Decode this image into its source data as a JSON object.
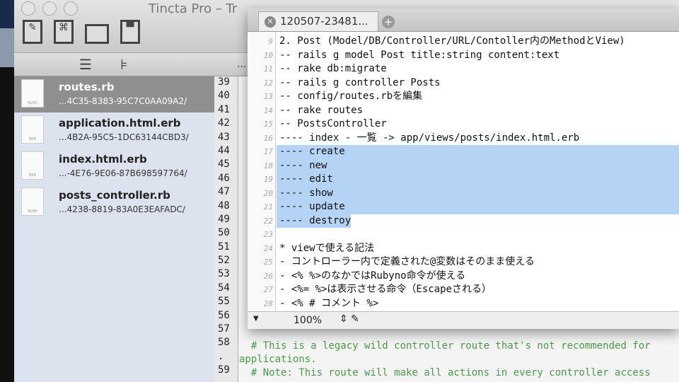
{
  "window": {
    "title": "Tincta Pro – Tr"
  },
  "toolbar": {
    "new": "new-document",
    "new_cmd": "⌘",
    "open": "open",
    "save": "save"
  },
  "sidebar": {
    "files": [
      {
        "name": "routes.rb",
        "path": "...4C35-8383-95C7C0AA09A2/",
        "type": "RUBY",
        "selected": true
      },
      {
        "name": "application.html.erb",
        "path": "...4B2A-95C5-1DC63144CBD3/",
        "type": "ERB"
      },
      {
        "name": "index.html.erb",
        "path": "...-4E76-9E06-87B698597764/",
        "type": "ERB"
      },
      {
        "name": "posts_controller.rb",
        "path": "...4238-8819-83A0E3EAFADC/",
        "type": "RUBY"
      }
    ]
  },
  "bg_editor": {
    "more": "...",
    "line_numbers": [
      "39",
      "40",
      "41",
      "42",
      "43",
      "44",
      "45",
      "46",
      "47",
      "48",
      "49",
      "50",
      "51",
      "52",
      "53",
      "54",
      "55",
      "56",
      "57",
      "58",
      ".",
      "59"
    ],
    "code": [
      "  # This is a legacy wild controller route that's not recommended for",
      "applications.",
      "  # Note: This route will make all actions in every controller access"
    ]
  },
  "front": {
    "tab": "120507-23481...",
    "lines": [
      {
        "n": "9",
        "t": "2. Post (Model/DB/Controller/URL/Contoller内のMethodとView)"
      },
      {
        "n": "10",
        "t": "-- rails g model Post title:string content:text"
      },
      {
        "n": "11",
        "t": "-- rake db:migrate"
      },
      {
        "n": "12",
        "t": "-- rails g controller Posts"
      },
      {
        "n": "13",
        "t": "-- config/routes.rbを編集"
      },
      {
        "n": "14",
        "t": "-- rake routes"
      },
      {
        "n": "15",
        "t": "-- PostsController"
      },
      {
        "n": "16",
        "t": "---- index - 一覧 -> app/views/posts/index.html.erb"
      },
      {
        "n": "17",
        "t": "---- create"
      },
      {
        "n": "18",
        "t": "---- new"
      },
      {
        "n": "19",
        "t": "---- edit"
      },
      {
        "n": "20",
        "t": "---- show"
      },
      {
        "n": "21",
        "t": "---- update"
      },
      {
        "n": "22",
        "t": "---- destroy"
      },
      {
        "n": "23",
        "t": ""
      },
      {
        "n": "24",
        "t": "* viewで使える記法"
      },
      {
        "n": "25",
        "t": "- コントローラー内で定義された@変数はそのまま使える"
      },
      {
        "n": "26",
        "t": "- <% %>のなかではRubyno命令が使える"
      },
      {
        "n": "27",
        "t": "- <%= %>は表示させる命令（Escapeされる）"
      },
      {
        "n": "28",
        "t": "- <% # コメント %>"
      }
    ],
    "zoom": "100%"
  }
}
